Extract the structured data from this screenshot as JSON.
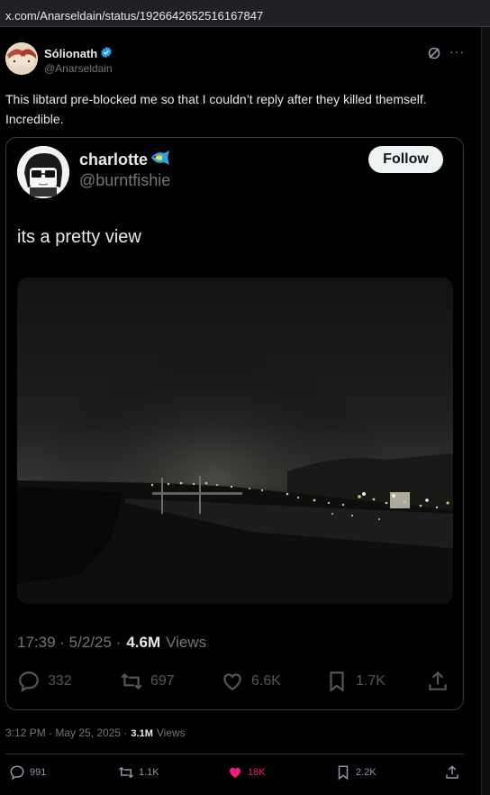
{
  "browser": {
    "url": "x.com/Anarseldain/status/1926642652516167847"
  },
  "post": {
    "author_name": "Sólionath",
    "author_handle": "@Anarseldain",
    "text": "This libtard pre-blocked me so that I couldn’t reply after they killed themself. Incredible.",
    "timestamp": "3:12 PM · May 25, 2025 ·",
    "views_count": "3.1M",
    "views_label": "Views",
    "actions": {
      "replies": "991",
      "reposts": "1.1K",
      "likes": "18K",
      "bookmarks": "2.2K"
    },
    "colors": {
      "like": "#f91880",
      "verified": "#1d9bf0"
    }
  },
  "quoted": {
    "author_name": "charlotte",
    "author_handle": "@burntfishie",
    "follow_label": "Follow",
    "text": "its a pretty view",
    "time": "17:39 · 5/2/25 ·",
    "views_count": "4.6M",
    "views_label": "Views",
    "actions": {
      "replies": "332",
      "reposts": "697",
      "likes": "6.6K",
      "bookmarks": "1.7K"
    }
  },
  "icons": [
    "verified-badge-icon",
    "grok-icon",
    "more-icon",
    "fish-emoji-icon",
    "reply-icon",
    "repost-icon",
    "like-icon",
    "bookmark-icon",
    "share-icon"
  ]
}
